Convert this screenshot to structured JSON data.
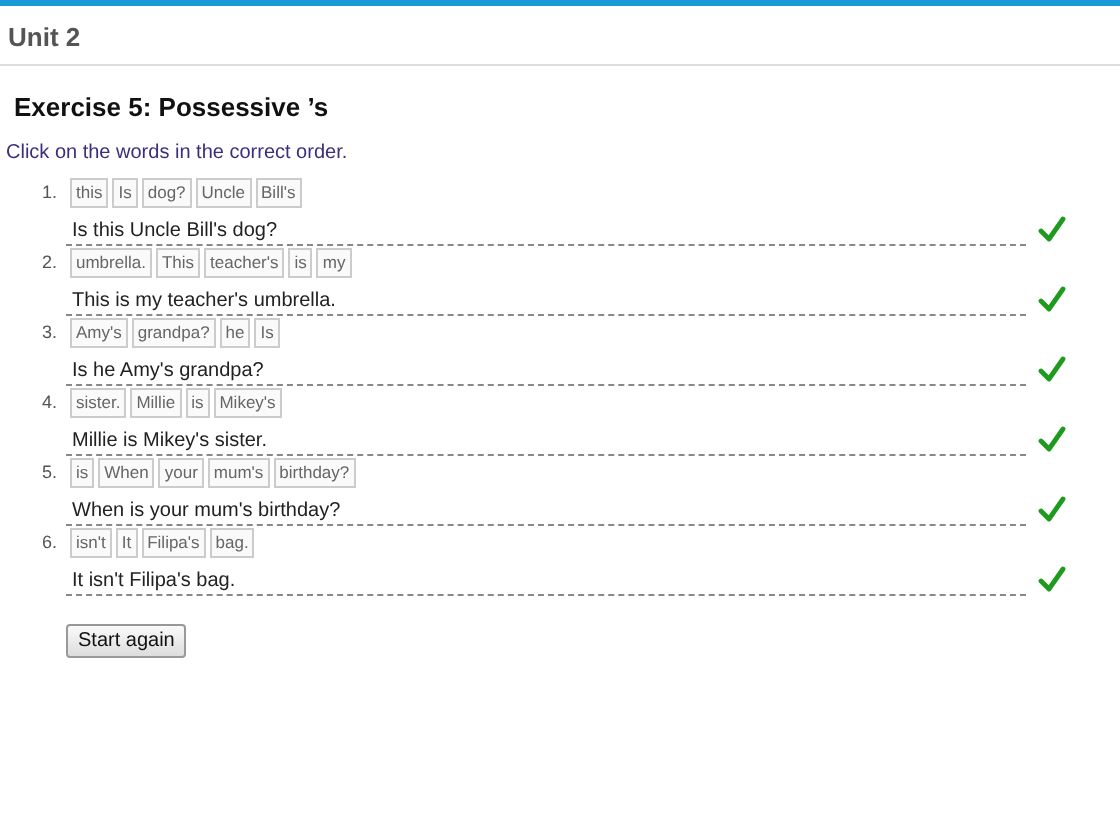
{
  "header": {
    "title": "Unit 2"
  },
  "exercise": {
    "title": "Exercise 5: Possessive ’s",
    "instruction": "Click on the words in the correct order."
  },
  "items": [
    {
      "number": "1.",
      "words": [
        "this",
        "Is",
        "dog?",
        "Uncle",
        "Bill's"
      ],
      "answer": "Is this Uncle Bill's dog?",
      "correct": true
    },
    {
      "number": "2.",
      "words": [
        "umbrella.",
        "This",
        "teacher's",
        "is",
        "my"
      ],
      "answer": "This is my teacher's umbrella.",
      "correct": true
    },
    {
      "number": "3.",
      "words": [
        "Amy's",
        "grandpa?",
        "he",
        "Is"
      ],
      "answer": "Is he Amy's grandpa?",
      "correct": true
    },
    {
      "number": "4.",
      "words": [
        "sister.",
        "Millie",
        "is",
        "Mikey's"
      ],
      "answer": "Millie is Mikey's sister.",
      "correct": true
    },
    {
      "number": "5.",
      "words": [
        "is",
        "When",
        "your",
        "mum's",
        "birthday?"
      ],
      "answer": "When is your mum's birthday?",
      "correct": true
    },
    {
      "number": "6.",
      "words": [
        "isn't",
        "It",
        "Filipa's",
        "bag."
      ],
      "answer": "It isn't Filipa's bag.",
      "correct": true
    }
  ],
  "buttons": {
    "start_again": "Start again"
  }
}
